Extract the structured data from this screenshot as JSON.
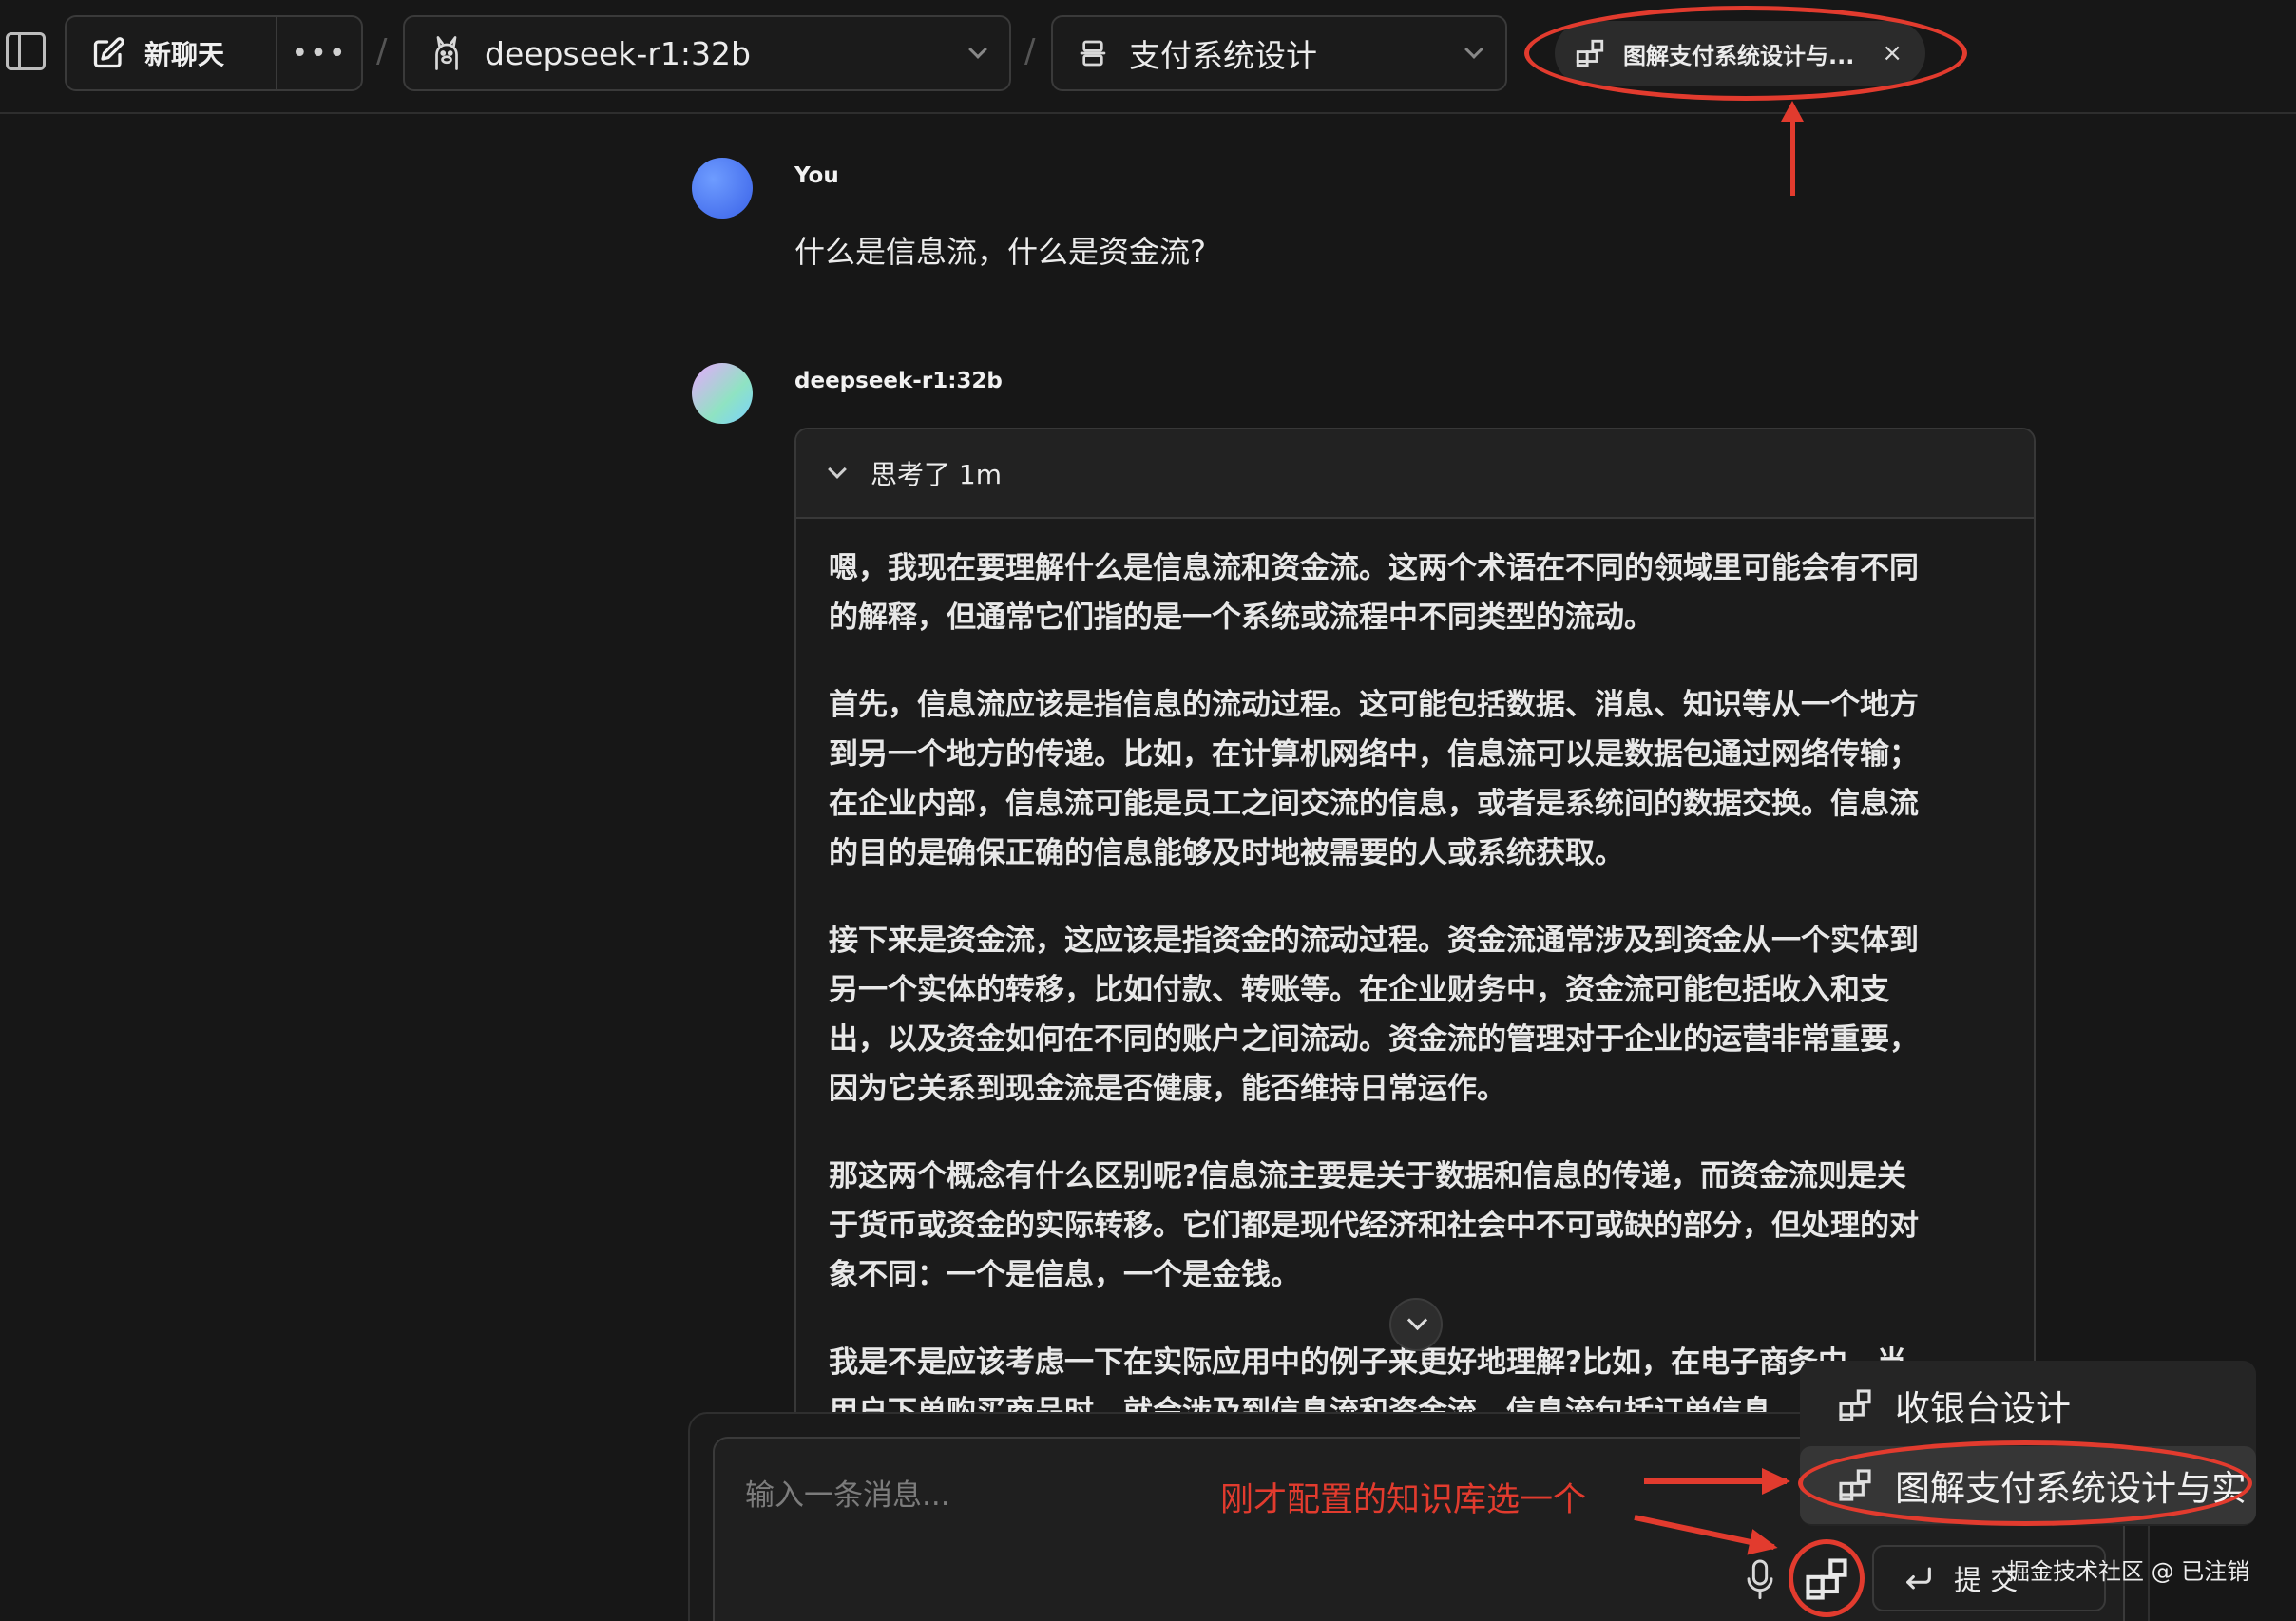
{
  "header": {
    "new_chat_label": "新聊天",
    "more_label": "•••",
    "separator": "/",
    "model_name": "deepseek-r1:32b",
    "knowledge_base_name": "支付系统设计",
    "selected_tag": "图解支付系统设计与...",
    "tag_close": "×"
  },
  "conversation": {
    "user_name": "You",
    "user_message": "什么是信息流，什么是资金流?",
    "bot_name": "deepseek-r1:32b",
    "thinking_label": "思考了 1m",
    "thinking_paragraphs": [
      "嗯，我现在要理解什么是信息流和资金流。这两个术语在不同的领域里可能会有不同的解释，但通常它们指的是一个系统或流程中不同类型的流动。",
      "首先，信息流应该是指信息的流动过程。这可能包括数据、消息、知识等从一个地方到另一个地方的传递。比如，在计算机网络中，信息流可以是数据包通过网络传输；在企业内部，信息流可能是员工之间交流的信息，或者是系统间的数据交换。信息流的目的是确保正确的信息能够及时地被需要的人或系统获取。",
      "接下来是资金流，这应该是指资金的流动过程。资金流通常涉及到资金从一个实体到另一个实体的转移，比如付款、转账等。在企业财务中，资金流可能包括收入和支出，以及资金如何在不同的账户之间流动。资金流的管理对于企业的运营非常重要，因为它关系到现金流是否健康，能否维持日常运作。",
      "那这两个概念有什么区别呢?信息流主要是关于数据和信息的传递，而资金流则是关于货币或资金的实际转移。它们都是现代经济和社会中不可或缺的部分，但处理的对象不同：一个是信息，一个是金钱。",
      "我是不是应该考虑一下在实际应用中的例子来更好地理解?比如，在电子商务中，当用户下单购买商品时，就会涉及到信息流和资金流。信息流包括订单信息"
    ]
  },
  "composer": {
    "placeholder": "输入一条消息...",
    "submit_label": "提 交"
  },
  "knowledge_menu": {
    "items": [
      "收银台设计",
      "图解支付系统设计与实"
    ]
  },
  "annotation": {
    "text": "刚才配置的知识库选一个"
  },
  "watermark": "掘金技术社区 @ 已注销",
  "colors": {
    "background": "#171717",
    "annotation_red": "#e23b2e",
    "user_avatar": "#4a78f0"
  }
}
